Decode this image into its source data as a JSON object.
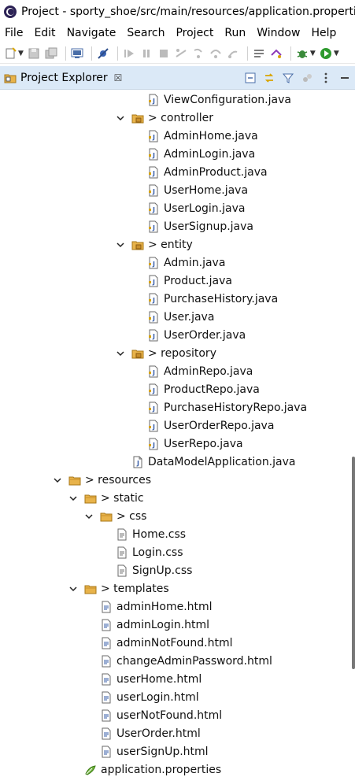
{
  "window": {
    "title": "Project - sporty_shoe/src/main/resources/application.properties"
  },
  "menu": [
    "File",
    "Edit",
    "Navigate",
    "Search",
    "Project",
    "Run",
    "Window",
    "Help"
  ],
  "view": {
    "tab_label": "Project Explorer",
    "close_glyph": "☒"
  },
  "tree": [
    {
      "label": "ViewConfiguration.java",
      "level": 3,
      "kind": "java-file",
      "icon": "java-file-icon"
    },
    {
      "label": "> controller",
      "level": 2,
      "kind": "package",
      "expanded": true,
      "icon": "package-icon"
    },
    {
      "label": "AdminHome.java",
      "level": 3,
      "kind": "java-file",
      "icon": "java-file-icon"
    },
    {
      "label": "AdminLogin.java",
      "level": 3,
      "kind": "java-file",
      "icon": "java-file-icon"
    },
    {
      "label": "AdminProduct.java",
      "level": 3,
      "kind": "java-file",
      "icon": "java-file-icon"
    },
    {
      "label": "UserHome.java",
      "level": 3,
      "kind": "java-file",
      "icon": "java-file-icon"
    },
    {
      "label": "UserLogin.java",
      "level": 3,
      "kind": "java-file",
      "icon": "java-file-icon"
    },
    {
      "label": "UserSignup.java",
      "level": 3,
      "kind": "java-file",
      "icon": "java-file-icon"
    },
    {
      "label": "> entity",
      "level": 2,
      "kind": "package",
      "expanded": true,
      "icon": "package-icon"
    },
    {
      "label": "Admin.java",
      "level": 3,
      "kind": "java-file",
      "icon": "java-file-icon"
    },
    {
      "label": "Product.java",
      "level": 3,
      "kind": "java-file",
      "icon": "java-file-icon"
    },
    {
      "label": "PurchaseHistory.java",
      "level": 3,
      "kind": "java-file",
      "icon": "java-file-icon"
    },
    {
      "label": "User.java",
      "level": 3,
      "kind": "java-file",
      "icon": "java-file-icon"
    },
    {
      "label": "UserOrder.java",
      "level": 3,
      "kind": "java-file",
      "icon": "java-file-icon"
    },
    {
      "label": "> repository",
      "level": 2,
      "kind": "package",
      "expanded": true,
      "icon": "package-icon"
    },
    {
      "label": "AdminRepo.java",
      "level": 3,
      "kind": "java-file",
      "icon": "java-file-icon"
    },
    {
      "label": "ProductRepo.java",
      "level": 3,
      "kind": "java-file",
      "icon": "java-file-icon"
    },
    {
      "label": "PurchaseHistoryRepo.java",
      "level": 3,
      "kind": "java-file",
      "icon": "java-file-icon"
    },
    {
      "label": "UserOrderRepo.java",
      "level": 3,
      "kind": "java-file",
      "icon": "java-file-icon"
    },
    {
      "label": "UserRepo.java",
      "level": 3,
      "kind": "java-file",
      "icon": "java-file-icon"
    },
    {
      "label": "DataModelApplication.java",
      "level": 2,
      "kind": "java-main",
      "icon": "java-class-icon"
    },
    {
      "label": "> resources",
      "level": 0,
      "kind": "folder",
      "expanded": true,
      "icon": "folder-icon"
    },
    {
      "label": "> static",
      "level": 1,
      "kind": "folder",
      "expanded": true,
      "icon": "folder-icon"
    },
    {
      "label": "> css",
      "level": 2,
      "kind": "folder",
      "expanded": true,
      "icon": "folder-icon"
    },
    {
      "label": "Home.css",
      "level": 3,
      "kind": "file",
      "icon": "css-file-icon"
    },
    {
      "label": "Login.css",
      "level": 3,
      "kind": "file",
      "icon": "css-file-icon"
    },
    {
      "label": "SignUp.css",
      "level": 3,
      "kind": "file",
      "icon": "css-file-icon"
    },
    {
      "label": "> templates",
      "level": 1,
      "kind": "folder",
      "expanded": true,
      "icon": "folder-icon"
    },
    {
      "label": "adminHome.html",
      "level": 2,
      "kind": "file",
      "icon": "html-file-icon"
    },
    {
      "label": "adminLogin.html",
      "level": 2,
      "kind": "file",
      "icon": "html-file-icon"
    },
    {
      "label": "adminNotFound.html",
      "level": 2,
      "kind": "file",
      "icon": "html-file-icon"
    },
    {
      "label": "changeAdminPassword.html",
      "level": 2,
      "kind": "file",
      "icon": "html-file-icon"
    },
    {
      "label": "userHome.html",
      "level": 2,
      "kind": "file",
      "icon": "html-file-icon"
    },
    {
      "label": "userLogin.html",
      "level": 2,
      "kind": "file",
      "icon": "html-file-icon"
    },
    {
      "label": "userNotFound.html",
      "level": 2,
      "kind": "file",
      "icon": "html-file-icon"
    },
    {
      "label": "UserOrder.html",
      "level": 2,
      "kind": "file",
      "icon": "html-file-icon"
    },
    {
      "label": "userSignUp.html",
      "level": 2,
      "kind": "file",
      "icon": "html-file-icon"
    },
    {
      "label": "application.properties",
      "level": 1,
      "kind": "properties",
      "icon": "properties-file-icon"
    }
  ],
  "colors": {
    "view_tab_bg": "#dbe9f7",
    "folder": "#e8b34a",
    "java_blue": "#3a5fa8"
  }
}
